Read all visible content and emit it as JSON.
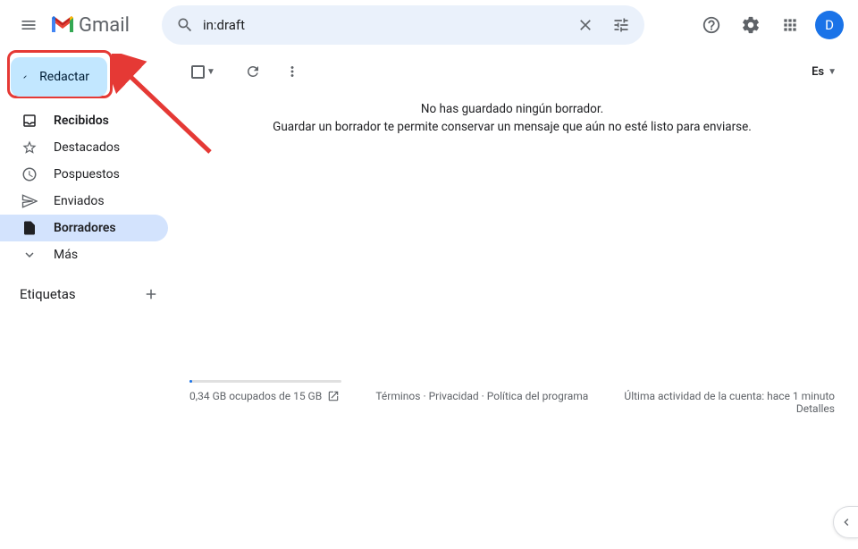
{
  "header": {
    "app_name": "Gmail",
    "search_value": "in:draft",
    "avatar_initial": "D"
  },
  "sidebar": {
    "compose_label": "Redactar",
    "items": [
      {
        "label": "Recibidos",
        "icon": "inbox"
      },
      {
        "label": "Destacados",
        "icon": "star"
      },
      {
        "label": "Pospuestos",
        "icon": "clock"
      },
      {
        "label": "Enviados",
        "icon": "send"
      },
      {
        "label": "Borradores",
        "icon": "file"
      },
      {
        "label": "Más",
        "icon": "chevron"
      }
    ],
    "labels_header": "Etiquetas"
  },
  "content": {
    "lang_label": "Es",
    "empty_line1": "No has guardado ningún borrador.",
    "empty_line2": "Guardar un borrador te permite conservar un mensaje que aún no esté listo para enviarse."
  },
  "footer": {
    "storage_text": "0,34 GB ocupados de 15 GB",
    "terms": "Términos",
    "privacy": "Privacidad",
    "program": "Política del programa",
    "activity": "Última actividad de la cuenta: hace 1 minuto",
    "details": "Detalles"
  }
}
